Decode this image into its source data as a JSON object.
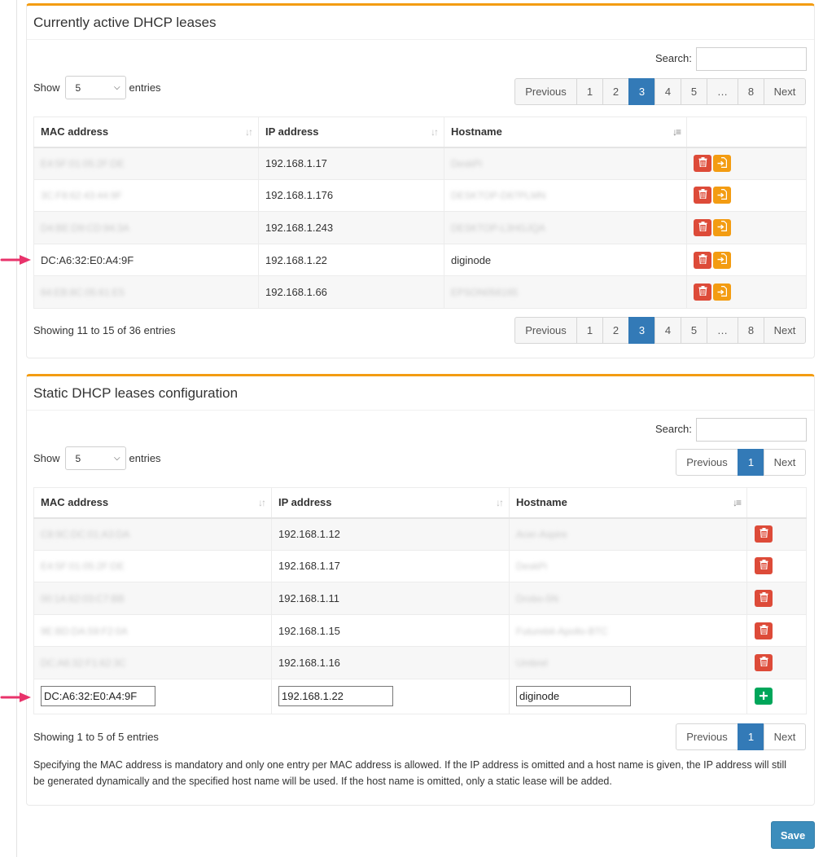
{
  "active": {
    "title": "Currently active DHCP leases",
    "search_label": "Search:",
    "show_label": "Show",
    "show_value": "5",
    "entries_label": "entries",
    "pager": [
      "Previous",
      "1",
      "2",
      "3",
      "4",
      "5",
      "…",
      "8",
      "Next"
    ],
    "columns": [
      "MAC address",
      "IP address",
      "Hostname"
    ],
    "rows": [
      {
        "mac": "E4:5F:01:05:2F:DE",
        "ip": "192.168.1.17",
        "host": "DeskPi"
      },
      {
        "mac": "3C:F8:62:43:44:9F",
        "ip": "192.168.1.176",
        "host": "DESKTOP-D87PLMN"
      },
      {
        "mac": "D4:BE:D9:CD:94:3A",
        "ip": "192.168.1.243",
        "host": "DESKTOP-L3HGJQA"
      },
      {
        "mac": "DC:A6:32:E0:A4:9F",
        "ip": "192.168.1.22",
        "host": "diginode"
      },
      {
        "mac": "64:EB:8C:05:61:E5",
        "ip": "192.168.1.66",
        "host": "EPSON056165"
      }
    ],
    "info": "Showing 11 to 15 of 36 entries"
  },
  "static": {
    "title": "Static DHCP leases configuration",
    "search_label": "Search:",
    "show_label": "Show",
    "show_value": "5",
    "entries_label": "entries",
    "pager": [
      "Previous",
      "1",
      "Next"
    ],
    "columns": [
      "MAC address",
      "IP address",
      "Hostname"
    ],
    "rows": [
      {
        "mac": "C8:9C:DC:01:A3:DA",
        "ip": "192.168.1.12",
        "host": "Acer-Aspire"
      },
      {
        "mac": "E4:5F:01:05:2F:DE",
        "ip": "192.168.1.17",
        "host": "DeskPi"
      },
      {
        "mac": "00:1A:62:03:C7:BB",
        "ip": "192.168.1.11",
        "host": "Drobo-5N"
      },
      {
        "mac": "9E:BD:DA:59:F2:0A",
        "ip": "192.168.1.15",
        "host": "Futurebit-Apollo-BTC"
      },
      {
        "mac": "DC:A6:32:F1:62:3C",
        "ip": "192.168.1.16",
        "host": "Umbrel"
      }
    ],
    "new_entry": {
      "mac": "DC:A6:32:E0:A4:9F",
      "ip": "192.168.1.22",
      "host": "diginode"
    },
    "info": "Showing 1 to 5 of 5 entries",
    "note": "Specifying the MAC address is mandatory and only one entry per MAC address is allowed. If the IP address is omitted and a host name is given, the IP address will still be generated dynamically and the specified host name will be used. If the host name is omitted, only a static lease will be added."
  },
  "save_label": "Save",
  "colors": {
    "box_accent": "#f39c12",
    "pager_active": "#337ab7",
    "delete_button": "#dd4b39",
    "static_button": "#f39c12",
    "add_button": "#00a65a",
    "save_button": "#3c8dbc",
    "arrow": "#e8336b"
  },
  "icons": [
    "sort-icon",
    "sort-desc-icon",
    "trash-icon",
    "file-import-icon",
    "plus-icon",
    "arrow-right-icon"
  ]
}
